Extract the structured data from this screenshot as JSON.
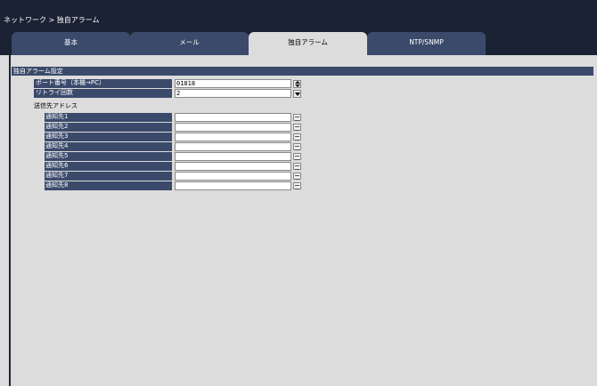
{
  "breadcrumb": "ネットワーク > 独自アラーム",
  "tabs": [
    {
      "label": "基本",
      "active": false
    },
    {
      "label": "メール",
      "active": false
    },
    {
      "label": "独自アラーム",
      "active": true
    },
    {
      "label": "NTP/SNMP",
      "active": false
    }
  ],
  "section": {
    "title": "独自アラーム設定"
  },
  "port": {
    "label": "ポート番号（本機→PC）",
    "value": "01818"
  },
  "retry": {
    "label": "リトライ回数",
    "value": "2"
  },
  "destinations": {
    "label": "送信先アドレス",
    "items": [
      {
        "label": "通知先1",
        "value": ""
      },
      {
        "label": "通知先2",
        "value": ""
      },
      {
        "label": "通知先3",
        "value": ""
      },
      {
        "label": "通知先4",
        "value": ""
      },
      {
        "label": "通知先5",
        "value": ""
      },
      {
        "label": "通知先6",
        "value": ""
      },
      {
        "label": "通知先7",
        "value": ""
      },
      {
        "label": "通知先8",
        "value": ""
      }
    ]
  },
  "colors": {
    "header_bg": "#1a2233",
    "label_bg": "#3b4a6b",
    "page_bg": "#dcdcdc"
  }
}
